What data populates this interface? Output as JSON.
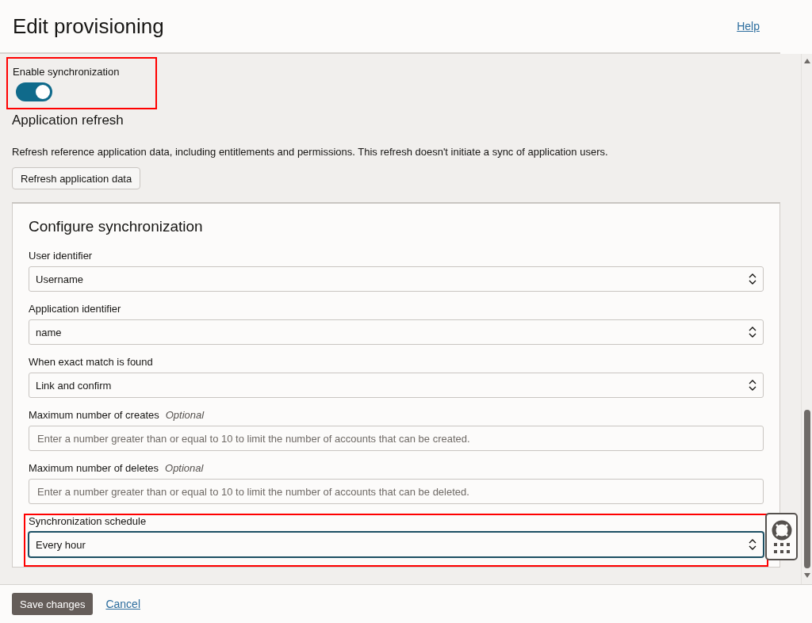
{
  "header": {
    "title": "Edit provisioning",
    "help_link": "Help"
  },
  "sync_toggle": {
    "label": "Enable synchronization",
    "on": true,
    "highlighted": true
  },
  "refresh": {
    "title": "Application refresh",
    "description": "Refresh reference application data, including entitlements and permissions. This refresh doesn't initiate a sync of application users.",
    "button": "Refresh application data"
  },
  "configure": {
    "title": "Configure synchronization",
    "fields": [
      {
        "kind": "select",
        "label": "User identifier",
        "value": "Username",
        "focused": false,
        "highlighted": false
      },
      {
        "kind": "select",
        "label": "Application identifier",
        "value": "name",
        "focused": false,
        "highlighted": false
      },
      {
        "kind": "select",
        "label": "When exact match is found",
        "value": "Link and confirm",
        "focused": false,
        "highlighted": false
      },
      {
        "kind": "text",
        "label": "Maximum number of creates",
        "hint": "Optional",
        "placeholder": "Enter a number greater than or equal to 10 to limit the number of accounts that can be created.",
        "focused": false,
        "highlighted": false
      },
      {
        "kind": "text",
        "label": "Maximum number of deletes",
        "hint": "Optional",
        "placeholder": "Enter a number greater than or equal to 10 to limit the number of accounts that can be deleted.",
        "focused": false,
        "highlighted": false
      },
      {
        "kind": "select",
        "label": "Synchronization schedule",
        "value": "Every hour",
        "focused": true,
        "highlighted": true
      }
    ]
  },
  "footer": {
    "save_button": "Save changes",
    "cancel_link": "Cancel"
  }
}
